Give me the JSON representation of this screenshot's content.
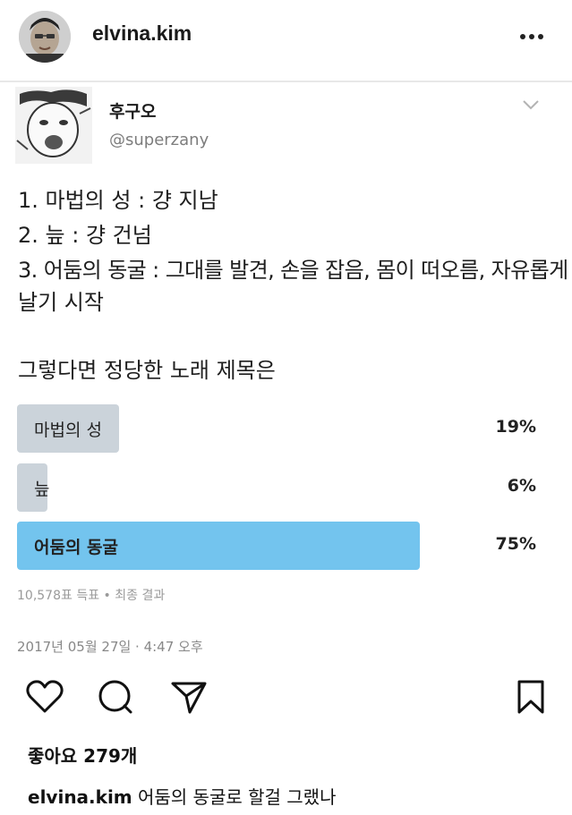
{
  "post": {
    "username": "elvina.kim",
    "more_icon": "more-horizontal-icon"
  },
  "tweet": {
    "name": "후구오",
    "handle": "@superzany",
    "lines": [
      "1. 마법의 성 : 걍 지남",
      "2. 늪 : 걍 건넘",
      "3. 어둠의 동굴 : 그대를 발견, 손을 잡음, 몸이 떠오름, 자유롭게",
      "날기 시작",
      "그렇다면 정당한 노래 제목은"
    ],
    "poll": {
      "options": [
        {
          "label": "마법의 성",
          "percent": "19%",
          "share": 0.19,
          "winner": false
        },
        {
          "label": "늪",
          "percent": "6%",
          "share": 0.06,
          "winner": false
        },
        {
          "label": "어둠의 동굴",
          "percent": "75%",
          "share": 0.75,
          "winner": true
        }
      ],
      "summary": "10,578표 득표 • 최종 결과"
    },
    "date": "2017년 05월 27일 · 4:47 오후"
  },
  "actions": {
    "like_icon": "heart-icon",
    "comment_icon": "comment-icon",
    "share_icon": "send-icon",
    "save_icon": "bookmark-icon"
  },
  "likes": "좋아요 279개",
  "caption": {
    "username": "elvina.kim",
    "text": "어둠의 동굴로 할걸 그랬나"
  }
}
